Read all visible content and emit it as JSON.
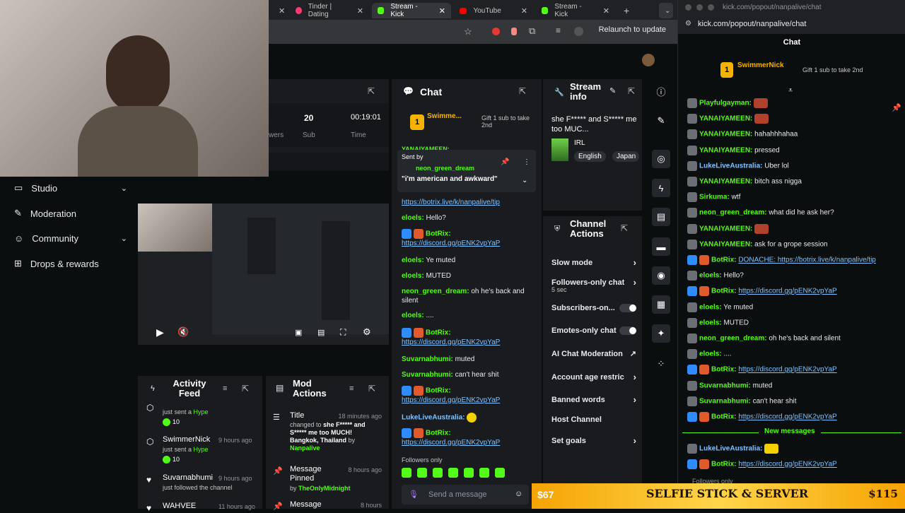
{
  "tabs": [
    {
      "label": "Tinder | Dating",
      "color": "#fe3c72"
    },
    {
      "label": "Stream - Kick",
      "color": "#53fc18"
    },
    {
      "label": "YouTube",
      "color": "#ff0000"
    },
    {
      "label": "Stream - Kick",
      "color": "#53fc18"
    }
  ],
  "browser": {
    "relaunch": "Relaunch to update",
    "new_tab": "+"
  },
  "stats": [
    {
      "value": "20",
      "label": "Sub"
    },
    {
      "value": "00:19:01",
      "label": "Time"
    }
  ],
  "stats_partial": "wers",
  "nav": [
    {
      "label": "Studio",
      "icon": "tv-icon",
      "chevron": true
    },
    {
      "label": "Moderation",
      "icon": "wrench-icon",
      "chevron": false
    },
    {
      "label": "Community",
      "icon": "people-icon",
      "chevron": true
    },
    {
      "label": "Drops & rewards",
      "icon": "gift-icon",
      "chevron": false
    }
  ],
  "chat_panel": {
    "title": "Chat",
    "top_gifter": "Swimme...",
    "top_gifter_count": "1",
    "gift_prompt": "Gift 1 sub to take 2nd",
    "pinned_label": "Sent by",
    "pinned_user": "neon_green_dream",
    "pinned_text": "\"i'm american and awkward\"",
    "partial_user": "YANAIYAMEEN:",
    "messages": [
      {
        "user": "",
        "text": "https://botrix.live/k/nanpalive/tip",
        "link": true
      },
      {
        "user": "eloels:",
        "text": "Hello?",
        "link": false
      },
      {
        "user": "BotRix:",
        "text": "https://discord.gg/pENK2vpYaP",
        "link": true
      },
      {
        "user": "eloels:",
        "text": "Ye muted",
        "link": false
      },
      {
        "user": "eloels:",
        "text": "MUTED",
        "link": false
      },
      {
        "user": "neon_green_dream:",
        "text": "oh he's back and silent",
        "link": false
      },
      {
        "user": "eloels:",
        "text": "....",
        "link": false
      },
      {
        "user": "BotRix:",
        "text": "https://discord.gg/pENK2vpYaP",
        "link": true
      },
      {
        "user": "Suvarnabhumi:",
        "text": "muted",
        "link": false
      },
      {
        "user": "Suvarnabhumi:",
        "text": "can't hear shit",
        "link": false
      },
      {
        "user": "BotRix:",
        "text": "https://discord.gg/pENK2vpYaP",
        "link": true
      },
      {
        "user": "LukeLiveAustralia:",
        "text": "",
        "link": false
      },
      {
        "user": "BotRix:",
        "text": "https://discord.gg/pENK2vpYaP",
        "link": true
      }
    ],
    "followers_only": "Followers only",
    "send_placeholder": "Send a message"
  },
  "stream_info": {
    "title": "Stream info",
    "stream_title": "she F***** and S***** me too MUC...",
    "category": "IRL",
    "tags": [
      "English",
      "Japan"
    ]
  },
  "channel_actions": {
    "title": "Channel Actions",
    "rows": [
      {
        "label": "Slow mode",
        "kind": "chevron",
        "sub": ""
      },
      {
        "label": "Followers-only chat",
        "kind": "chevron",
        "sub": "5 sec"
      },
      {
        "label": "Subscribers-on...",
        "kind": "toggle",
        "sub": ""
      },
      {
        "label": "Emotes-only chat",
        "kind": "toggle",
        "sub": ""
      },
      {
        "label": "AI Chat Moderation",
        "kind": "external",
        "sub": ""
      },
      {
        "label": "Account age restric",
        "kind": "chevron",
        "sub": ""
      },
      {
        "label": "Banned words",
        "kind": "chevron",
        "sub": ""
      },
      {
        "label": "Host Channel",
        "kind": "none",
        "sub": ""
      },
      {
        "label": "Set goals",
        "kind": "chevron",
        "sub": ""
      }
    ]
  },
  "activity_feed": {
    "title": "Activity Feed",
    "items": [
      {
        "name": "",
        "action": "just sent a",
        "highlight": "Hype",
        "time": "",
        "count": "10"
      },
      {
        "name": "SwimmerNick",
        "action": "just sent a",
        "highlight": "Hype",
        "time": "9 hours ago",
        "count": "10"
      },
      {
        "name": "Suvarnabhumi",
        "action": "just followed the channel",
        "highlight": "",
        "time": "9 hours ago",
        "count": ""
      },
      {
        "name": "WAHVEE",
        "action": "",
        "highlight": "",
        "time": "11 hours ago",
        "count": ""
      }
    ]
  },
  "mod_actions": {
    "title": "Mod Actions",
    "items": [
      {
        "title": "Title",
        "time": "18 minutes ago",
        "detail_pre": "changed to",
        "detail_bold": "she F***** and S***** me too MUCH! Bangkok, Thailand",
        "detail_by": "by",
        "user": "Nanpalive"
      },
      {
        "title": "Message Pinned",
        "time": "8 hours ago",
        "detail_pre": "",
        "detail_bold": "",
        "detail_by": "by",
        "user": "TheOnlyMidnight"
      },
      {
        "title": "Message",
        "time": "8 hours",
        "detail_pre": "",
        "detail_bold": "",
        "detail_by": "",
        "user": ""
      }
    ]
  },
  "popout": {
    "url": "kick.com/popout/nanpalive/chat",
    "title_url": "kick.com/popout/nanpalive/chat",
    "header": "Chat",
    "top_gifter": "SwimmerNick",
    "top_gifter_count": "1",
    "gift_prompt": "Gift 1 sub to take 2nd",
    "new_messages": "New messages",
    "messages": [
      {
        "user": "Playfulgayman:",
        "text": "",
        "color": "#53fc18",
        "link": false,
        "emote": true
      },
      {
        "user": "YANAIYAMEEN:",
        "text": "",
        "color": "#53fc18",
        "link": false,
        "emote": true
      },
      {
        "user": "YANAIYAMEEN:",
        "text": "hahahhhahaa",
        "color": "#53fc18",
        "link": false,
        "emote": false
      },
      {
        "user": "YANAIYAMEEN:",
        "text": "pressed",
        "color": "#53fc18",
        "link": false,
        "emote": false
      },
      {
        "user": "LukeLiveAustralia:",
        "text": "Uber lol",
        "color": "#7dc3ff",
        "link": false,
        "emote": false
      },
      {
        "user": "YANAIYAMEEN:",
        "text": "bitch ass nigga",
        "color": "#53fc18",
        "link": false,
        "emote": false
      },
      {
        "user": "Sirkuma:",
        "text": "wtf",
        "color": "#53fc18",
        "link": false,
        "emote": false
      },
      {
        "user": "neon_green_dream:",
        "text": "what did he ask her?",
        "color": "#53fc18",
        "link": false,
        "emote": false
      },
      {
        "user": "YANAIYAMEEN:",
        "text": "",
        "color": "#53fc18",
        "link": false,
        "emote": true
      },
      {
        "user": "YANAIYAMEEN:",
        "text": "ask for a grope session",
        "color": "#53fc18",
        "link": false,
        "emote": false
      },
      {
        "user": "BotRix:",
        "text": "DONACHE: https://botrix.live/k/nanpalive/tip",
        "color": "#53fc18",
        "link": true,
        "emote": false
      },
      {
        "user": "eloels:",
        "text": "Hello?",
        "color": "#53fc18",
        "link": false,
        "emote": false
      },
      {
        "user": "BotRix:",
        "text": "https://discord.gg/pENK2vpYaP",
        "color": "#53fc18",
        "link": true,
        "emote": false
      },
      {
        "user": "eloels:",
        "text": "Ye muted",
        "color": "#53fc18",
        "link": false,
        "emote": false
      },
      {
        "user": "eloels:",
        "text": "MUTED",
        "color": "#53fc18",
        "link": false,
        "emote": false
      },
      {
        "user": "neon_green_dream:",
        "text": "oh he's back and silent",
        "color": "#53fc18",
        "link": false,
        "emote": false
      },
      {
        "user": "eloels:",
        "text": "....",
        "color": "#53fc18",
        "link": false,
        "emote": false
      },
      {
        "user": "BotRix:",
        "text": "https://discord.gg/pENK2vpYaP",
        "color": "#53fc18",
        "link": true,
        "emote": false
      },
      {
        "user": "Suvarnabhumi:",
        "text": "muted",
        "color": "#53fc18",
        "link": false,
        "emote": false
      },
      {
        "user": "Suvarnabhumi:",
        "text": "can't hear shit",
        "color": "#53fc18",
        "link": false,
        "emote": false
      },
      {
        "user": "BotRix:",
        "text": "https://discord.gg/pENK2vpYaP",
        "color": "#53fc18",
        "link": true,
        "emote": false
      }
    ],
    "after_new": [
      {
        "user": "LukeLiveAustralia:",
        "text": "",
        "color": "#7dc3ff",
        "link": false,
        "emote": true
      },
      {
        "user": "BotRix:",
        "text": "https://discord.gg/pENK2vpYaP",
        "color": "#53fc18",
        "link": true,
        "emote": false
      }
    ],
    "footer_partial": "Followers only"
  },
  "banner": {
    "left_amount": "$67",
    "text": "SELFIE STICK & SERVER",
    "right_amount": "$115"
  },
  "colors": {
    "kick_green": "#53fc18",
    "panel": "#191b1f",
    "bg": "#0b0e0f",
    "link": "#7dc3ff",
    "banner": "#f5a302"
  }
}
